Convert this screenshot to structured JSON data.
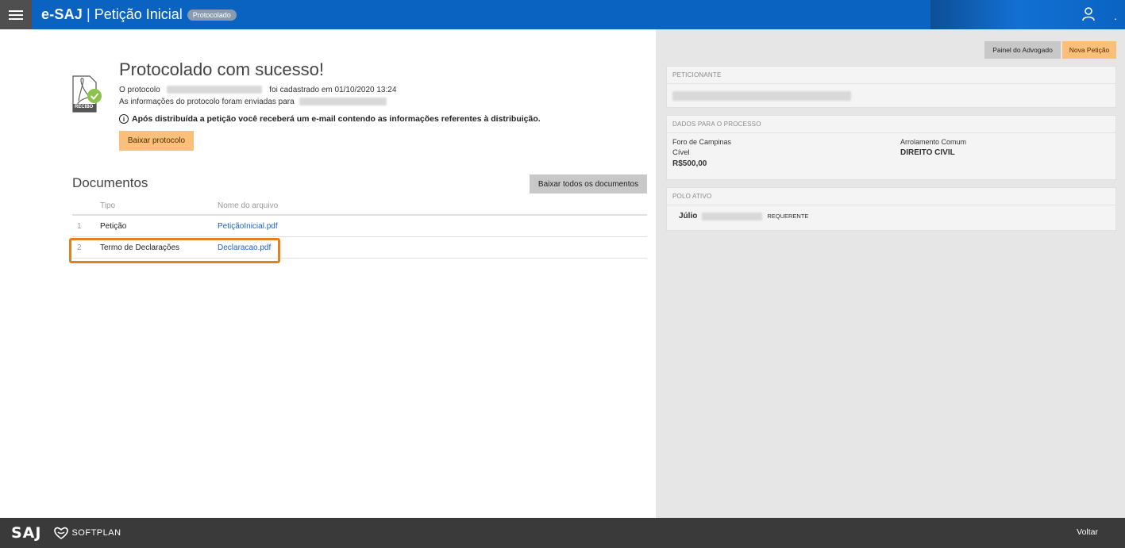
{
  "header": {
    "brand": "e-SAJ",
    "separator": "|",
    "title": "Petição Inicial",
    "status_badge": "Protocolado",
    "menu_icon": "hamburger-menu-icon",
    "user_icon": "user-icon",
    "more": "."
  },
  "success": {
    "title": "Protocolado com sucesso!",
    "protocol_prefix": "O protocolo",
    "protocol_suffix": "foi cadastrado em 01/10/2020 13:24",
    "sent_to": "As informações do protocolo foram enviadas para",
    "notice": "Após distribuída a petição você receberá um e-mail contendo as informações referentes à distribuição.",
    "download_button": "Baixar protocolo",
    "receipt_label": "RECIBO"
  },
  "documents": {
    "title": "Documentos",
    "download_all_button": "Baixar todos os documentos",
    "columns": [
      "Tipo",
      "Nome do arquivo"
    ],
    "rows": [
      {
        "num": "1",
        "tipo": "Petição",
        "file": "PetiçãoInicial.pdf"
      },
      {
        "num": "2",
        "tipo": "Termo de Declarações",
        "file": "Declaracao.pdf"
      }
    ]
  },
  "side": {
    "painel_button": "Painel do Advogado",
    "nova_button": "Nova Petição",
    "peticionante": {
      "header": "PETICIONANTE"
    },
    "dados": {
      "header": "DADOS PARA O PROCESSO",
      "foro": "Foro de Campinas",
      "classe": "Cível",
      "valor": "R$500,00",
      "rito": "Arrolamento Comum",
      "area": "DIREITO CIVIL"
    },
    "polo": {
      "header": "POLO ATIVO",
      "name": "Júlio",
      "role": "REQUERENTE"
    }
  },
  "footer": {
    "logo": "SAJ",
    "softplan": "SOFTPLAN",
    "back": "Voltar"
  },
  "colors": {
    "header_blue": "#0a63c1",
    "accent_orange": "#fbbf79",
    "highlight_orange": "#e4811d",
    "link_blue": "#1c63c7",
    "footer_dark": "#3a3a3a"
  }
}
